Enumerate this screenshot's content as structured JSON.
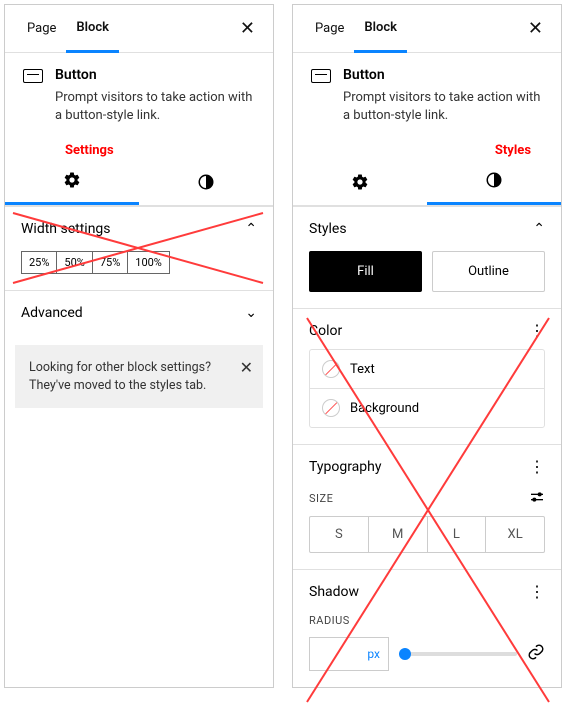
{
  "left": {
    "tabs": {
      "page": "Page",
      "block": "Block"
    },
    "block": {
      "title": "Button",
      "desc": "Prompt visitors to take action with a button-style link."
    },
    "annotation": "Settings",
    "sections": {
      "width": {
        "title": "Width settings",
        "options": [
          "25%",
          "50%",
          "75%",
          "100%"
        ]
      },
      "advanced": {
        "title": "Advanced"
      }
    },
    "notice": "Looking for other block settings? They've moved to the styles tab."
  },
  "right": {
    "tabs": {
      "page": "Page",
      "block": "Block"
    },
    "block": {
      "title": "Button",
      "desc": "Prompt visitors to take action with a button-style link."
    },
    "annotation": "Styles",
    "styles": {
      "title": "Styles",
      "fill": "Fill",
      "outline": "Outline"
    },
    "color": {
      "title": "Color",
      "text": "Text",
      "background": "Background"
    },
    "typography": {
      "title": "Typography",
      "size_label": "SIZE",
      "sizes": [
        "S",
        "M",
        "L",
        "XL"
      ]
    },
    "shadow": {
      "title": "Shadow",
      "radius_label": "RADIUS",
      "unit": "px"
    }
  }
}
